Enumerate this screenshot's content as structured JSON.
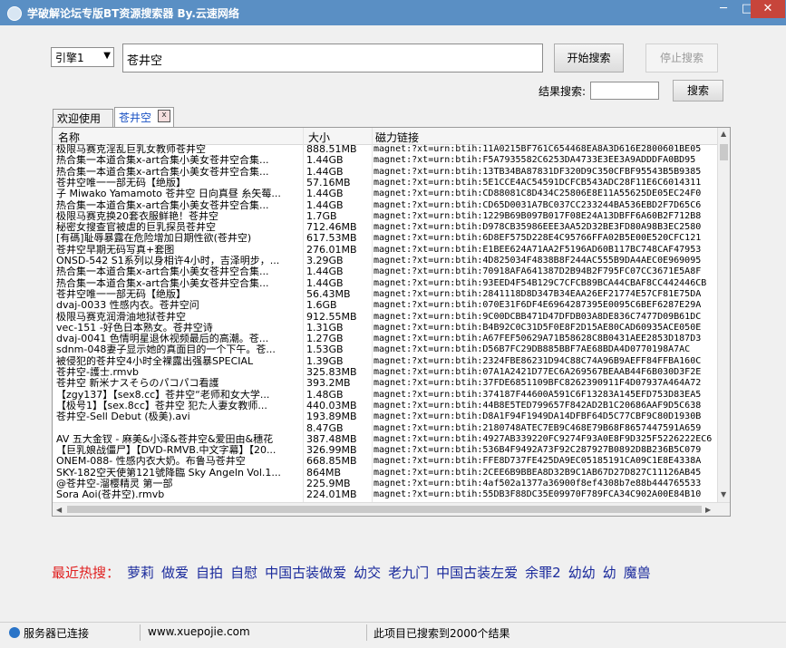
{
  "window": {
    "title": "学破解论坛专版BT资源搜索器 By.云速网络",
    "minimize_label": "─",
    "maximize_label": "□",
    "close_label": "✕"
  },
  "search": {
    "engine_selected": "引擎1",
    "query": "苍井空",
    "start_label": "开始搜索",
    "stop_label": "停止搜索",
    "result_search_label": "结果搜索:",
    "result_search_value": "",
    "result_search_button": "搜索"
  },
  "tabs": [
    {
      "label": "欢迎使用"
    },
    {
      "label": "苍井空",
      "close_label": "x"
    }
  ],
  "table": {
    "columns": [
      "名称",
      "大小",
      "磁力链接"
    ],
    "rows": [
      [
        "极限马赛克淫乱巨乳女教师苍井空",
        "888.51MB",
        "magnet:?xt=urn:btih:11A0215BF761C654468EA8A3D616E2800601BE05"
      ],
      [
        "热合集一本道合集x-art合集小美女苍井空合集...",
        "1.44GB",
        "magnet:?xt=urn:btih:F5A7935582C6253DA4733E3EE3A9ADDDFA0BD95"
      ],
      [
        "热合集一本道合集x-art合集小美女苍井空合集...",
        "1.44GB",
        "magnet:?xt=urn:btih:13TB34BA87831DF320D9C350CFBF95543B5B9385"
      ],
      [
        "苍井空唯一一部无码【绝版】",
        "57.16MB",
        "magnet:?xt=urn:btih:5E1CCE4AC54591DCFCB543ADC28F11E6C6014311"
      ],
      [
        "子 Miwako Yamamoto 苍井空 日向真昼 糸矢莓...",
        "1.44GB",
        "magnet:?xt=urn:btih:CD88081C8D434C25806E8E11A55625DE05EC24F0"
      ],
      [
        "热合集一本道合集x-art合集小美女苍井空合集...",
        "1.44GB",
        "magnet:?xt=urn:btih:CD65D0031A7BC037CC233244BA536EBD2F7D65C6"
      ],
      [
        "极限马赛克换20套衣服鲜艳！苍井空",
        "1.7GB",
        "magnet:?xt=urn:btih:1229B69B097B017F08E24A13DBFF6A60B2F712B8"
      ],
      [
        "秘密女搜查官被虐的巨乳探员苍井空",
        "712.46MB",
        "magnet:?xt=urn:btih:D978CB35986EEE3AA52D32BE3FD80A98B3EC2580"
      ],
      [
        "[有碼]耻辱暴露在危险增加日期性欲(苍井空)",
        "617.53MB",
        "magnet:?xt=urn:btih:6D8EF575D228E4C95766FFA02B5E00E520CFC121"
      ],
      [
        "苍井空早期无码写真+套图",
        "276.01MB",
        "magnet:?xt=urn:btih:E1BEE624A71AA2F5196AD60B117BC748CAF47953"
      ],
      [
        "ONSD-542 S1系列以身相许4小时，吉泽明步，...",
        "3.29GB",
        "magnet:?xt=urn:btih:4D825034F4838B8F244AC555B9DA4AEC0E969095"
      ],
      [
        "热合集一本道合集x-art合集小美女苍井空合集...",
        "1.44GB",
        "magnet:?xt=urn:btih:70918AFA641387D2B94B2F795FC07CC3671E5A8F"
      ],
      [
        "热合集一本道合集x-art合集小美女苍井空合集...",
        "1.44GB",
        "magnet:?xt=urn:btih:93EED4F54B129C7CFCB89BCA44CBAF8CC442446CB"
      ],
      [
        "苍井空唯一一部无码【绝版】",
        "56.43MB",
        "magnet:?xt=urn:btih:2841118D8D347B34EAA26EF21774E57CF81E75DA"
      ],
      [
        "dvaj-0033 性感内衣。苍井空问",
        "1.6GB",
        "magnet:?xt=urn:btih:070E31F6DF4E6964287395E0095C6BEF6287E29A"
      ],
      [
        "极限马赛克润滑油地狱苍井空",
        "912.55MB",
        "magnet:?xt=urn:btih:9C00DCBB471D47DFDB03A8DE836C7477D09B61DC"
      ],
      [
        "vec-151 -好色日本熟女。苍井空诗",
        "1.31GB",
        "magnet:?xt=urn:btih:B4B92C0C31D5F0E8F2D15AE80CAD60935ACE050E"
      ],
      [
        "dvaj-0041 色情明星退休视频最后的高潮。苍...",
        "1.27GB",
        "magnet:?xt=urn:btih:A67FEF50629A71B58628C8B0431AEE2853D187D3"
      ],
      [
        "sdnm-048妻子显示她的真面目的一个下午。苍...",
        "1.53GB",
        "magnet:?xt=urn:btih:D56B7FC29DB885BBF7AE68BDA4D0770198A7AC"
      ],
      [
        "被侵犯的苍井空4小时全裸露出强暴SPECIAL",
        "1.39GB",
        "magnet:?xt=urn:btih:2324FBE86231D94C88C74A96B9AEFF84FFBA160C"
      ],
      [
        "苍井空-護士.rmvb",
        "325.83MB",
        "magnet:?xt=urn:btih:07A1A2421D77EC6A269567BEAAB44F6B030D3F2E"
      ],
      [
        "苍井空 新米ナスそらのパコパコ看護",
        "393.2MB",
        "magnet:?xt=urn:btih:37FDE6851109BFC8262390911F4D07937A464A72"
      ],
      [
        "【zgy137】【sex8.cc】苍井空“老师和女大学...",
        "1.48GB",
        "magnet:?xt=urn:btih:374187F44600A591C6F13283A145EFD753D83EA5"
      ],
      [
        "【极号1】【sex.8cc】苍井空 犯た人妻女教师...",
        "440.03MB",
        "magnet:?xt=urn:btih:44B8E5TED799657F842AD2B1C20686AAF9D5C638"
      ],
      [
        "苍井空-Sell Debut (极美).avi",
        "193.89MB",
        "magnet:?xt=urn:btih:D8A1F94F1949DA14DFBF64D5C77CBF9C80D1930B"
      ],
      [
        "",
        "8.47GB",
        "magnet:?xt=urn:btih:2180748ATEC7EB9C468E79B68F8657447591A659"
      ],
      [
        "AV 五大金钗 - 麻美&小泽&苍井空&爱田由&穗花",
        "387.48MB",
        "magnet:?xt=urn:btih:4927AB339220FC9274F93A0E8F9D325F5226222EC6"
      ],
      [
        "【巨乳娘战僵尸】【DVD-RMVB.中文字幕】【20...",
        "326.99MB",
        "magnet:?xt=urn:btih:536B4F9492A73F92C287927B0892D8B236B5C079"
      ],
      [
        "ONEM-088- 性感内衣大奶。布鲁马苍井空",
        "668.85MB",
        "magnet:?xt=urn:btih:FFE8D737FE425DA9EC05185191CA09C1E8E4338A"
      ],
      [
        "SKY-182空天使第121號降臨 Sky Angeln Vol.1...",
        "864MB",
        "magnet:?xt=urn:btih:2CEE6B9BBEA8D32B9C1AB67D27D827C11126AB45"
      ],
      [
        "@苍井空-溜樱精灵 第一部",
        "225.9MB",
        "magnet:?xt=urn:btih:4af502a1377a36900f8ef4308b7e88b444765533"
      ],
      [
        "Sora Aoi(苍井空).rmvb",
        "224.01MB",
        "magnet:?xt=urn:btih:55DB3F88DC35E09970F789FCA34C902A00E84B10"
      ]
    ]
  },
  "hot": {
    "label": "最近热搜：",
    "terms": [
      "萝莉",
      "做爱",
      "自拍",
      "自慰",
      "中国古装做爱",
      "幼交",
      "老九门",
      "中国古装左爱",
      "余罪2",
      "幼幼",
      "幼",
      "魔兽"
    ]
  },
  "status": {
    "connection": "服务器已连接",
    "site": "www.xuepojie.com",
    "result": "此项目已搜索到2000个结果"
  },
  "colors": {
    "titlebar": "#5a8fc4",
    "hot_label": "#e02020",
    "hot_link": "#1a2a9c",
    "active_tab_text": "#1a52c4"
  }
}
